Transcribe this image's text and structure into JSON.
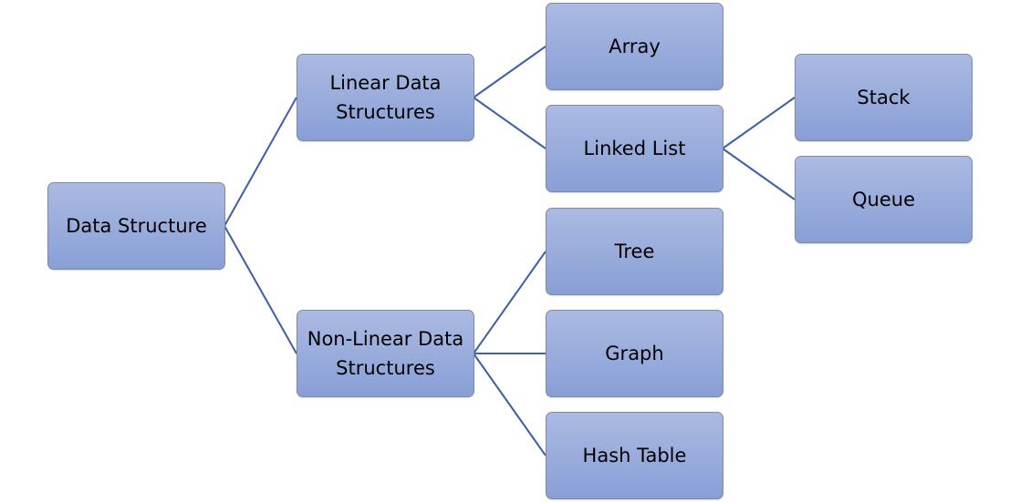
{
  "diagram": {
    "type": "tree",
    "line_color": "#3d5fa6",
    "box_color_top": "#abbae2",
    "box_color_bottom": "#889fd6",
    "nodes": [
      {
        "id": "root",
        "label": "Data Structure"
      },
      {
        "id": "linear",
        "label": "Linear Data Structures",
        "parent": "root"
      },
      {
        "id": "nonlinear",
        "label": "Non-Linear Data Structures",
        "parent": "root"
      },
      {
        "id": "array",
        "label": "Array",
        "parent": "linear"
      },
      {
        "id": "linkedlist",
        "label": "Linked List",
        "parent": "linear"
      },
      {
        "id": "tree",
        "label": "Tree",
        "parent": "nonlinear"
      },
      {
        "id": "graph",
        "label": "Graph",
        "parent": "nonlinear"
      },
      {
        "id": "hashtable",
        "label": "Hash Table",
        "parent": "nonlinear"
      },
      {
        "id": "stack",
        "label": "Stack",
        "parent": "linkedlist"
      },
      {
        "id": "queue",
        "label": "Queue",
        "parent": "linkedlist"
      }
    ]
  }
}
